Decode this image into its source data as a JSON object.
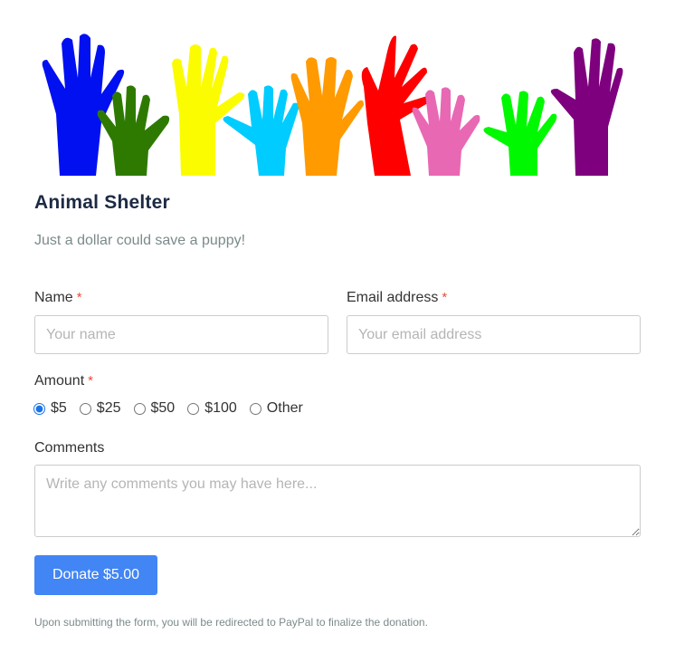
{
  "banner": {
    "alt": "Raised hands in many colors",
    "hand_colors": [
      "#0010f0",
      "#2e7a00",
      "#fcfc00",
      "#00ccff",
      "#ff9a00",
      "#ff0000",
      "#e868b4",
      "#00f800",
      "#7e007e"
    ]
  },
  "header": {
    "title": "Animal Shelter",
    "subtitle": "Just a dollar could save a puppy!"
  },
  "form": {
    "name": {
      "label": "Name",
      "required_mark": "*",
      "placeholder": "Your name",
      "value": ""
    },
    "email": {
      "label": "Email address",
      "required_mark": "*",
      "placeholder": "Your email address",
      "value": ""
    },
    "amount": {
      "label": "Amount",
      "required_mark": "*",
      "options": [
        {
          "label": "$5",
          "value": "5",
          "checked": true
        },
        {
          "label": "$25",
          "value": "25",
          "checked": false
        },
        {
          "label": "$50",
          "value": "50",
          "checked": false
        },
        {
          "label": "$100",
          "value": "100",
          "checked": false
        },
        {
          "label": "Other",
          "value": "other",
          "checked": false
        }
      ]
    },
    "comments": {
      "label": "Comments",
      "placeholder": "Write any comments you may have here...",
      "value": ""
    },
    "submit_label": "Donate $5.00",
    "note": "Upon submitting the form, you will be redirected to PayPal to finalize the donation."
  },
  "colors": {
    "accent": "#4285f4",
    "required": "#e74c3c",
    "title": "#1d2a44",
    "muted": "#7b8a8b"
  }
}
